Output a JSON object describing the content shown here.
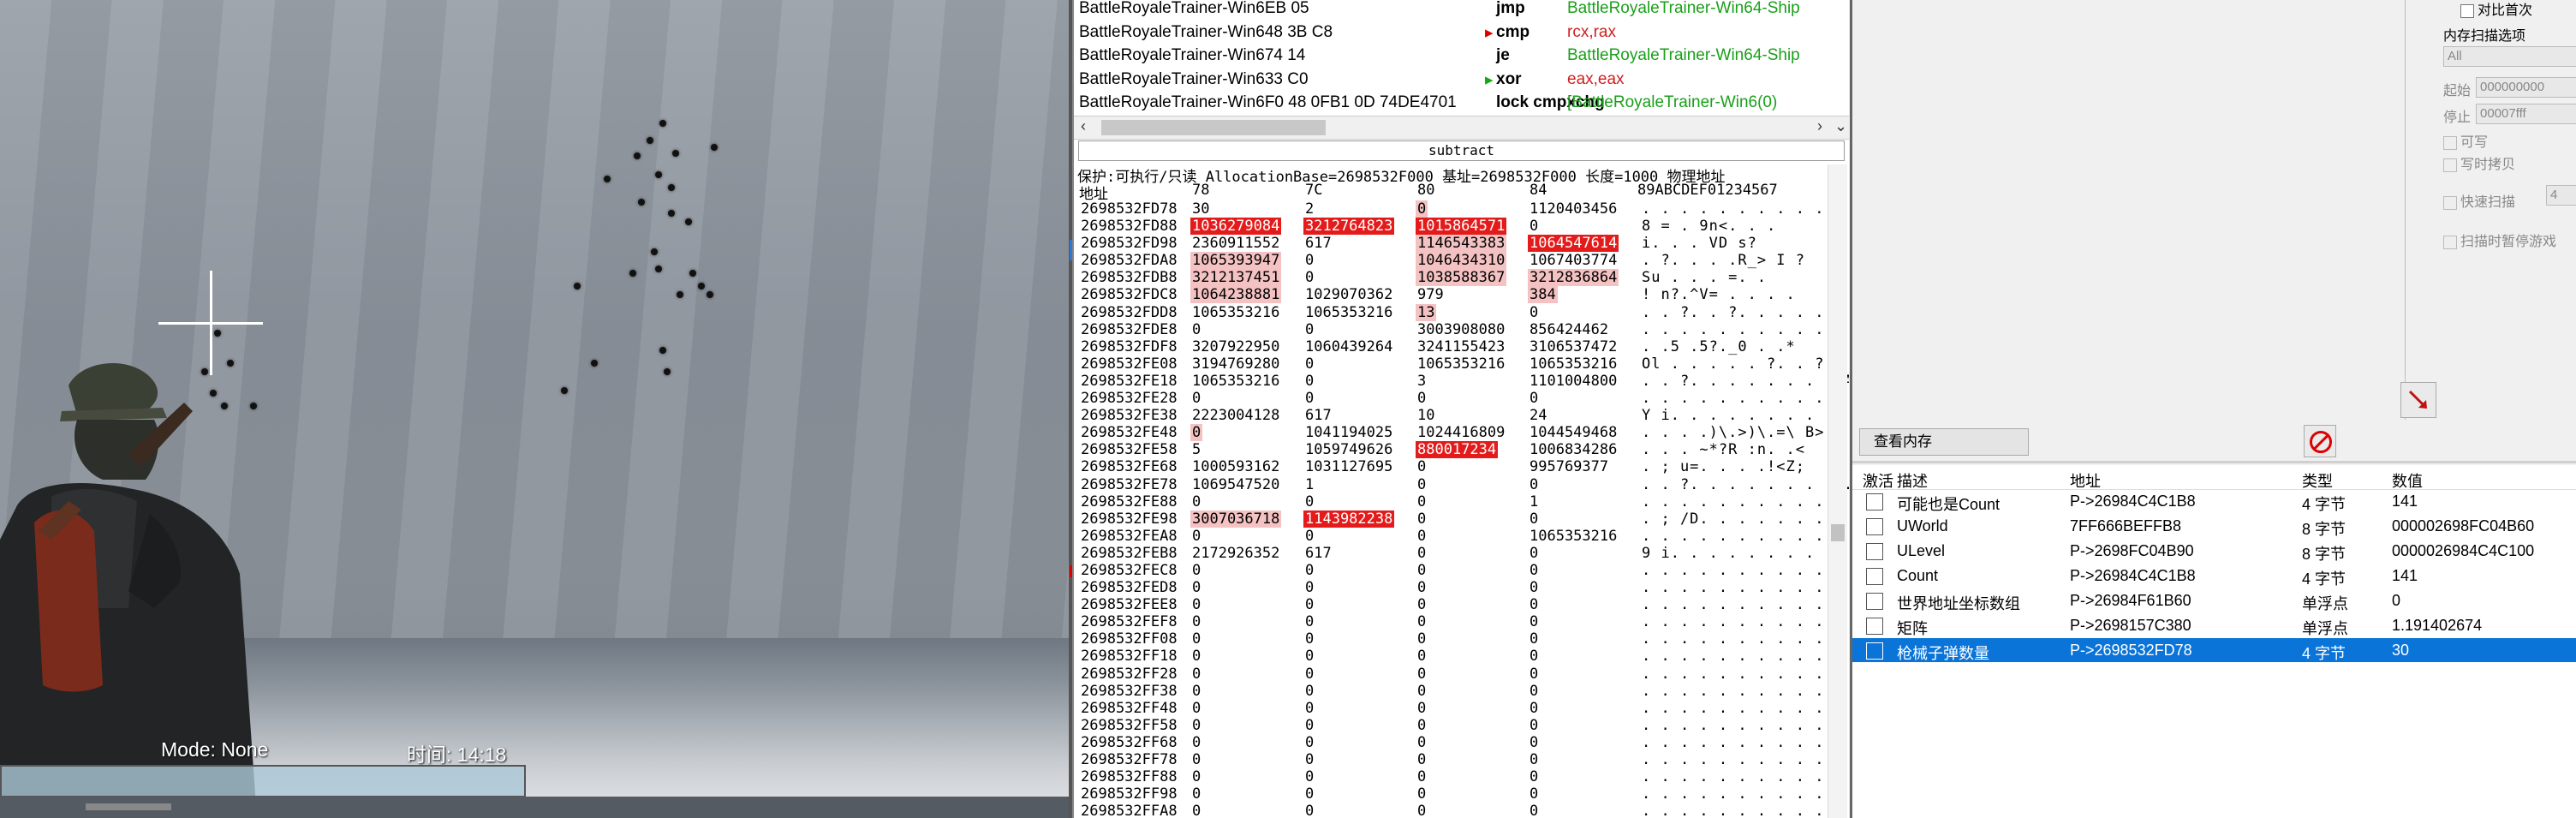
{
  "game": {
    "hud_mode_label": "Mode: None",
    "hud_time_label": "时间: 14:18"
  },
  "disassembler": {
    "rows": [
      {
        "address": "BattleRoyaleTrainer-Win6EB 05",
        "mnemonic": "jmp",
        "operand": "BattleRoyaleTrainer-Win64-Ship",
        "operand_color": "#1aa01a"
      },
      {
        "address": "BattleRoyaleTrainer-Win648 3B C8",
        "mnemonic": "cmp",
        "operand": "rcx,rax",
        "operand_color": "#d02020"
      },
      {
        "address": "BattleRoyaleTrainer-Win674 14",
        "mnemonic": "je",
        "operand": "BattleRoyaleTrainer-Win64-Ship",
        "operand_color": "#1aa01a"
      },
      {
        "address": "BattleRoyaleTrainer-Win633 C0",
        "mnemonic": "xor",
        "operand": "eax,eax",
        "operand_color": "#d02020"
      },
      {
        "address": "BattleRoyaleTrainer-Win6F0 48 0FB1 0D 74DE4701",
        "mnemonic": "lock cmpxchg",
        "operand": "[BattleRoyaleTrainer-Win6(0)",
        "operand_color": "#1aa01a"
      }
    ],
    "subtract_label": "subtract"
  },
  "memory": {
    "info_line": "保护:可执行/只读  AllocationBase=2698532F000 基址=2698532F000 长度=1000 物理地址",
    "headers": {
      "address": "地址",
      "c78": "78",
      "c7c": "7C",
      "c80": "80",
      "c84": "84",
      "ascii": "89ABCDEF01234567"
    },
    "rows": [
      {
        "a": "2698532FD78",
        "v": [
          "30",
          "2",
          "0",
          "1120403456"
        ],
        "s": ". . . . . . . . . . . B",
        "h": [
          0,
          0,
          1,
          0
        ]
      },
      {
        "a": "2698532FD88",
        "v": [
          "1036279084",
          "3212764823",
          "1015864571",
          "0"
        ],
        "s": "8 = .  9n<. . .",
        "h": [
          2,
          2,
          2,
          0
        ]
      },
      {
        "a": "2698532FD98",
        "v": [
          "2360911552",
          "617",
          "1146543383",
          "1064547614"
        ],
        "s": "i. . . VD  s?",
        "h": [
          0,
          0,
          1,
          2
        ]
      },
      {
        "a": "2698532FDA8",
        "v": [
          "1065393947",
          "0",
          "1046434310",
          "1067403774"
        ],
        "s": ".  ?. . . .R_> I ?",
        "h": [
          1,
          0,
          1,
          0
        ]
      },
      {
        "a": "2698532FDB8",
        "v": [
          "3212137451",
          "0",
          "1038588367",
          "3212836864"
        ],
        "s": "Su  . . .    =. .",
        "h": [
          1,
          0,
          1,
          1
        ]
      },
      {
        "a": "2698532FDC8",
        "v": [
          "1064238881",
          "1029070362",
          "979",
          "384"
        ],
        "s": "! n?.^V= . . . .",
        "h": [
          1,
          0,
          0,
          1
        ]
      },
      {
        "a": "2698532FDD8",
        "v": [
          "1065353216",
          "1065353216",
          "13",
          "0"
        ],
        "s": ". . ?. . ?. . . . .",
        "h": [
          0,
          0,
          1,
          0
        ]
      },
      {
        "a": "2698532FDE8",
        "v": [
          "0",
          "0",
          "3003908080",
          "856424462"
        ],
        "s": ". . . . . . . . . . . 3",
        "h": [
          0,
          0,
          0,
          0
        ]
      },
      {
        "a": "2698532FDF8",
        "v": [
          "3207922950",
          "1060439264",
          "3241155423",
          "3106537472"
        ],
        "s": ". .5  .5?._0 . .*",
        "h": [
          0,
          0,
          0,
          0
        ]
      },
      {
        "a": "2698532FE08",
        "v": [
          "3194769280",
          "0",
          "1065353216",
          "1065353216"
        ],
        "s": "Ol  . . . . . ?. . ?",
        "h": [
          0,
          0,
          0,
          0
        ]
      },
      {
        "a": "2698532FE18",
        "v": [
          "1065353216",
          "0",
          "3",
          "1101004800"
        ],
        "s": ". . ?. . . . . . . . A",
        "h": [
          0,
          0,
          0,
          0
        ]
      },
      {
        "a": "2698532FE28",
        "v": [
          "0",
          "0",
          "0",
          "0"
        ],
        "s": ". . . . . . . . . . . . . .",
        "h": [
          0,
          0,
          0,
          0
        ]
      },
      {
        "a": "2698532FE38",
        "v": [
          "2223004128",
          "617",
          "10",
          "24"
        ],
        "s": " Y  i. . . . . . . . .",
        "h": [
          0,
          0,
          0,
          0
        ]
      },
      {
        "a": "2698532FE48",
        "v": [
          "0",
          "1041194025",
          "1024416809",
          "1044549468"
        ],
        "s": ". . . .)\\.>)\\.=\\ B>",
        "h": [
          1,
          0,
          0,
          0
        ]
      },
      {
        "a": "2698532FE58",
        "v": [
          "5",
          "1059749626",
          "880017234",
          "1006834286"
        ],
        "s": ". . . ~*?R :n. .<",
        "h": [
          0,
          0,
          2,
          0
        ]
      },
      {
        "a": "2698532FE68",
        "v": [
          "1000593162",
          "1031127695",
          "0",
          "995769377"
        ],
        "s": ".  ;  u=. . . .!<Z;",
        "h": [
          0,
          0,
          0,
          0
        ]
      },
      {
        "a": "2698532FE78",
        "v": [
          "1069547520",
          "1",
          "0",
          "0"
        ],
        "s": ". . ?. . . . . . . . . . .",
        "h": [
          0,
          0,
          0,
          0
        ]
      },
      {
        "a": "2698532FE88",
        "v": [
          "0",
          "0",
          "0",
          "1"
        ],
        "s": ". . . . . . . . . . . . . .",
        "h": [
          0,
          0,
          0,
          0
        ]
      },
      {
        "a": "2698532FE98",
        "v": [
          "3007036718",
          "1143982238",
          "0",
          "0"
        ],
        "s": ". ;  /D. . . . . . .",
        "h": [
          1,
          2,
          0,
          0
        ]
      },
      {
        "a": "2698532FEA8",
        "v": [
          "0",
          "0",
          "0",
          "1065353216"
        ],
        "s": ". . . . . . . . . . . . ?",
        "h": [
          0,
          0,
          0,
          0
        ]
      },
      {
        "a": "2698532FEB8",
        "v": [
          "2172926352",
          "617",
          "0",
          "0"
        ],
        "s": " 9  i. . . . . . . . .",
        "h": [
          0,
          0,
          0,
          0
        ]
      },
      {
        "a": "2698532FEC8",
        "v": [
          "0",
          "0",
          "0",
          "0"
        ],
        "s": ". . . . . . . . . . . . . .",
        "h": [
          0,
          0,
          0,
          0
        ]
      },
      {
        "a": "2698532FED8",
        "v": [
          "0",
          "0",
          "0",
          "0"
        ],
        "s": ". . . . . . . . . . . . . .",
        "h": [
          0,
          0,
          0,
          0
        ]
      },
      {
        "a": "2698532FEE8",
        "v": [
          "0",
          "0",
          "0",
          "0"
        ],
        "s": ". . . . . . . . . . . . . .",
        "h": [
          0,
          0,
          0,
          0
        ]
      },
      {
        "a": "2698532FEF8",
        "v": [
          "0",
          "0",
          "0",
          "0"
        ],
        "s": ". . . . . . . . . . . . . .",
        "h": [
          0,
          0,
          0,
          0
        ]
      },
      {
        "a": "2698532FF08",
        "v": [
          "0",
          "0",
          "0",
          "0"
        ],
        "s": ". . . . . . . . . . . . . .",
        "h": [
          0,
          0,
          0,
          0
        ]
      },
      {
        "a": "2698532FF18",
        "v": [
          "0",
          "0",
          "0",
          "0"
        ],
        "s": ". . . . . . . . . . . . . .",
        "h": [
          0,
          0,
          0,
          0
        ]
      },
      {
        "a": "2698532FF28",
        "v": [
          "0",
          "0",
          "0",
          "0"
        ],
        "s": ". . . . . . . . . . . . . .",
        "h": [
          0,
          0,
          0,
          0
        ]
      },
      {
        "a": "2698532FF38",
        "v": [
          "0",
          "0",
          "0",
          "0"
        ],
        "s": ". . . . . . . . . . . . . .",
        "h": [
          0,
          0,
          0,
          0
        ]
      },
      {
        "a": "2698532FF48",
        "v": [
          "0",
          "0",
          "0",
          "0"
        ],
        "s": ". . . . . . . . . . . . . .",
        "h": [
          0,
          0,
          0,
          0
        ]
      },
      {
        "a": "2698532FF58",
        "v": [
          "0",
          "0",
          "0",
          "0"
        ],
        "s": ". . . . . . . . . . . . . .",
        "h": [
          0,
          0,
          0,
          0
        ]
      },
      {
        "a": "2698532FF68",
        "v": [
          "0",
          "0",
          "0",
          "0"
        ],
        "s": ". . . . . . . . . . . . . .",
        "h": [
          0,
          0,
          0,
          0
        ]
      },
      {
        "a": "2698532FF78",
        "v": [
          "0",
          "0",
          "0",
          "0"
        ],
        "s": ". . . . . . . . . . . . . .",
        "h": [
          0,
          0,
          0,
          0
        ]
      },
      {
        "a": "2698532FF88",
        "v": [
          "0",
          "0",
          "0",
          "0"
        ],
        "s": ". . . . . . . . . . . . . .",
        "h": [
          0,
          0,
          0,
          0
        ]
      },
      {
        "a": "2698532FF98",
        "v": [
          "0",
          "0",
          "0",
          "0"
        ],
        "s": ". . . . . . . . . . . . . .",
        "h": [
          0,
          0,
          0,
          0
        ]
      },
      {
        "a": "2698532FFA8",
        "v": [
          "0",
          "0",
          "0",
          "0"
        ],
        "s": ". . . . . . . . . . . . . .",
        "h": [
          0,
          0,
          0,
          0
        ]
      }
    ]
  },
  "scan_options": {
    "compare_label": "对比首次",
    "section_label": "内存扫描选项",
    "region_value": "All",
    "start_label": "起始",
    "start_value": "000000000",
    "stop_label": "停止",
    "stop_value": "00007fff",
    "writable_label": "可写",
    "cow_label": "写时拷贝",
    "fast_scan_label": "快速扫描",
    "fast_scan_value": "4",
    "pause_label": "扫描时暂停游戏"
  },
  "cheat_table": {
    "view_memory_label": "查看内存",
    "headers": {
      "active": "激活",
      "desc": "描述",
      "address": "地址",
      "type": "类型",
      "value": "数值"
    },
    "rows": [
      {
        "desc": "可能也是Count",
        "address": "P->26984C4C1B8",
        "type": "4 字节",
        "value": "141"
      },
      {
        "desc": "UWorld",
        "address": "7FF666BEFFB8",
        "type": "8 字节",
        "value": "000002698FC04B60"
      },
      {
        "desc": "ULevel",
        "address": "P->2698FC04B90",
        "type": "8 字节",
        "value": "0000026984C4C100"
      },
      {
        "desc": "Count",
        "address": "P->26984C4C1B8",
        "type": "4 字节",
        "value": "141"
      },
      {
        "desc": "世界地址坐标数组",
        "address": "P->26984F61B60",
        "type": "单浮点",
        "value": "0"
      },
      {
        "desc": "矩阵",
        "address": "P->2698157C380",
        "type": "单浮点",
        "value": "1.191402674"
      },
      {
        "desc": "枪械子弹数量",
        "address": "P->2698532FD78",
        "type": "4 字节",
        "value": "30"
      }
    ]
  }
}
